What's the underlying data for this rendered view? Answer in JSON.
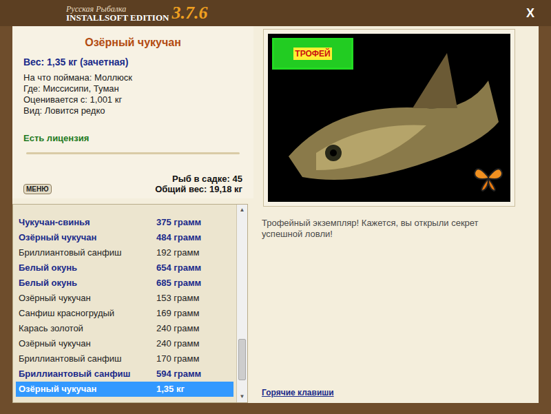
{
  "window": {
    "title_top": "Русская Рыбалка",
    "title_bottom": "INSTALLSOFT EDITION",
    "version": "3.7.6",
    "close": "X"
  },
  "fish_info": {
    "name": "Озёрный чукучан",
    "weight": "Вес: 1,35 кг (зачетная)",
    "details": [
      "На что поймана: Моллюск",
      "Где: Миссисипи, Туман",
      "Оценивается с: 1,001 кг",
      "Вид: Ловится редко"
    ],
    "license": "Есть лицензия"
  },
  "menu_button": "МЕНЮ",
  "keepnet": {
    "count": "Рыб в садке: 45",
    "total": "Общий вес: 19,18 кг"
  },
  "catch_list": {
    "rows": [
      {
        "name": "Чукучан-свинья",
        "weight": "375 грамм",
        "highlighted": true,
        "selected": false
      },
      {
        "name": "Озёрный чукучан",
        "weight": "484 грамм",
        "highlighted": true,
        "selected": false
      },
      {
        "name": "Бриллиантовый санфиш",
        "weight": "192 грамм",
        "highlighted": false,
        "selected": false
      },
      {
        "name": "Белый окунь",
        "weight": "654 грамм",
        "highlighted": true,
        "selected": false
      },
      {
        "name": "Белый окунь",
        "weight": "685 грамм",
        "highlighted": true,
        "selected": false
      },
      {
        "name": "Озёрный чукучан",
        "weight": "153 грамм",
        "highlighted": false,
        "selected": false
      },
      {
        "name": "Санфиш красногрудый",
        "weight": "169 грамм",
        "highlighted": false,
        "selected": false
      },
      {
        "name": "Карась золотой",
        "weight": "240 грамм",
        "highlighted": false,
        "selected": false
      },
      {
        "name": "Озёрный чукучан",
        "weight": "240 грамм",
        "highlighted": false,
        "selected": false
      },
      {
        "name": "Бриллиантовый санфиш",
        "weight": "170 грамм",
        "highlighted": false,
        "selected": false
      },
      {
        "name": "Бриллиантовый санфиш",
        "weight": "594 грамм",
        "highlighted": true,
        "selected": false
      },
      {
        "name": "Озёрный чукучан",
        "weight": "1,35 кг",
        "highlighted": true,
        "selected": true
      }
    ],
    "scroll": {
      "up": "▲",
      "down": "▼",
      "level": 0.92
    }
  },
  "photo": {
    "badge": "ТРОФЕЙ"
  },
  "message": "Трофейный экземпляр! Кажется, вы открыли секрет успешной ловли!",
  "hotkeys_link": "Горячие клавиши"
}
